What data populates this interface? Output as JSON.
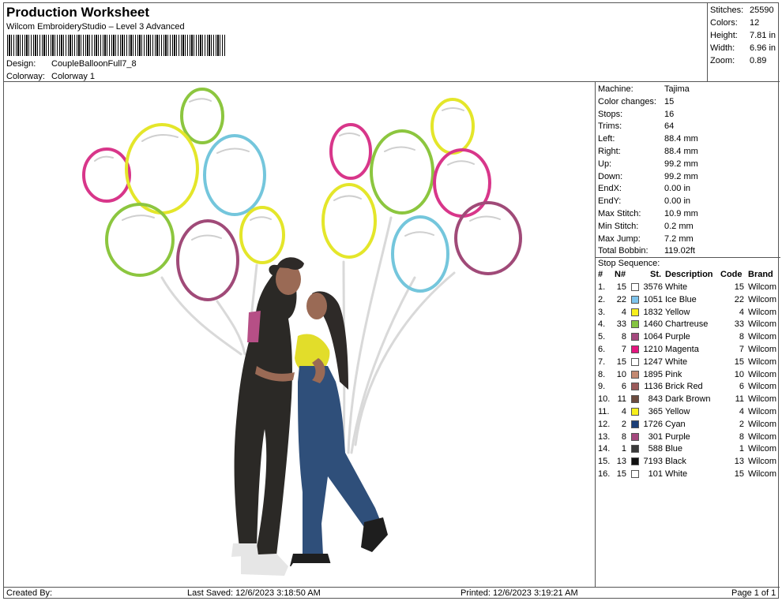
{
  "header": {
    "title": "Production Worksheet",
    "subtitle": "Wilcom EmbroideryStudio – Level 3 Advanced",
    "design_label": "Design:",
    "design_value": "CoupleBalloonFull7_8",
    "colorway_label": "Colorway:",
    "colorway_value": "Colorway 1"
  },
  "stats": [
    {
      "label": "Stitches:",
      "value": "25590"
    },
    {
      "label": "Colors:",
      "value": "12"
    },
    {
      "label": "Height:",
      "value": "7.81 in"
    },
    {
      "label": "Width:",
      "value": "6.96 in"
    },
    {
      "label": "Zoom:",
      "value": "0.89"
    }
  ],
  "properties": [
    {
      "label": "Machine:",
      "value": "Tajima"
    },
    {
      "label": "Color changes:",
      "value": "15"
    },
    {
      "label": "Stops:",
      "value": "16"
    },
    {
      "label": "Trims:",
      "value": "64"
    },
    {
      "label": "Left:",
      "value": "88.4 mm"
    },
    {
      "label": "Right:",
      "value": "88.4 mm"
    },
    {
      "label": "Up:",
      "value": "99.2 mm"
    },
    {
      "label": "Down:",
      "value": "99.2 mm"
    },
    {
      "label": "EndX:",
      "value": "0.00 in"
    },
    {
      "label": "EndY:",
      "value": "0.00 in"
    },
    {
      "label": "Max Stitch:",
      "value": "10.9 mm"
    },
    {
      "label": "Min Stitch:",
      "value": "0.2 mm"
    },
    {
      "label": "Max Jump:",
      "value": "7.2 mm"
    },
    {
      "label": "Total Bobbin:",
      "value": "119.02ft"
    }
  ],
  "stop_sequence": {
    "title": "Stop Sequence:",
    "columns": [
      "#",
      "N#",
      "St.",
      "Description",
      "Code",
      "Brand"
    ],
    "rows": [
      {
        "idx": "1.",
        "n": "15",
        "color": "#ffffff",
        "st": "3576",
        "desc": "White",
        "code": "15",
        "brand": "Wilcom"
      },
      {
        "idx": "2.",
        "n": "22",
        "color": "#7ec4ec",
        "st": "1051",
        "desc": "Ice Blue",
        "code": "22",
        "brand": "Wilcom"
      },
      {
        "idx": "3.",
        "n": "4",
        "color": "#f7ef1c",
        "st": "1832",
        "desc": "Yellow",
        "code": "4",
        "brand": "Wilcom"
      },
      {
        "idx": "4.",
        "n": "33",
        "color": "#84c441",
        "st": "1460",
        "desc": "Chartreuse",
        "code": "33",
        "brand": "Wilcom"
      },
      {
        "idx": "5.",
        "n": "8",
        "color": "#a4487e",
        "st": "1064",
        "desc": "Purple",
        "code": "8",
        "brand": "Wilcom"
      },
      {
        "idx": "6.",
        "n": "7",
        "color": "#e4157f",
        "st": "1210",
        "desc": "Magenta",
        "code": "7",
        "brand": "Wilcom"
      },
      {
        "idx": "7.",
        "n": "15",
        "color": "#ffffff",
        "st": "1247",
        "desc": "White",
        "code": "15",
        "brand": "Wilcom"
      },
      {
        "idx": "8.",
        "n": "10",
        "color": "#c48a72",
        "st": "1895",
        "desc": "Pink",
        "code": "10",
        "brand": "Wilcom"
      },
      {
        "idx": "9.",
        "n": "6",
        "color": "#9b5a5a",
        "st": "1136",
        "desc": "Brick Red",
        "code": "6",
        "brand": "Wilcom"
      },
      {
        "idx": "10.",
        "n": "11",
        "color": "#6b4b3e",
        "st": "843",
        "desc": "Dark Brown",
        "code": "11",
        "brand": "Wilcom"
      },
      {
        "idx": "11.",
        "n": "4",
        "color": "#f7ef1c",
        "st": "365",
        "desc": "Yellow",
        "code": "4",
        "brand": "Wilcom"
      },
      {
        "idx": "12.",
        "n": "2",
        "color": "#1c3f78",
        "st": "1726",
        "desc": "Cyan",
        "code": "2",
        "brand": "Wilcom"
      },
      {
        "idx": "13.",
        "n": "8",
        "color": "#a4487e",
        "st": "301",
        "desc": "Purple",
        "code": "8",
        "brand": "Wilcom"
      },
      {
        "idx": "14.",
        "n": "1",
        "color": "#3a3a3a",
        "st": "588",
        "desc": "Blue",
        "code": "1",
        "brand": "Wilcom"
      },
      {
        "idx": "15.",
        "n": "13",
        "color": "#111111",
        "st": "7193",
        "desc": "Black",
        "code": "13",
        "brand": "Wilcom"
      },
      {
        "idx": "16.",
        "n": "15",
        "color": "#ffffff",
        "st": "101",
        "desc": "White",
        "code": "15",
        "brand": "Wilcom"
      }
    ]
  },
  "footer": {
    "created_by": "Created By:",
    "last_saved": "Last Saved: 12/6/2023 3:18:50 AM",
    "printed": "Printed: 12/6/2023 3:19:21 AM",
    "page": "Page 1 of 1"
  },
  "design_colors": {
    "balloon_magenta": "#d8368a",
    "balloon_yellow": "#e4e62a",
    "balloon_green": "#8cc63f",
    "balloon_blue": "#74c6dc",
    "balloon_purple": "#a04a78",
    "string": "#d9d9d9",
    "hair": "#2e2a28",
    "skin": "#9a6a55",
    "shirt": "#2b2926",
    "jeans": "#2f4f7a",
    "top": "#e2dd2a"
  }
}
